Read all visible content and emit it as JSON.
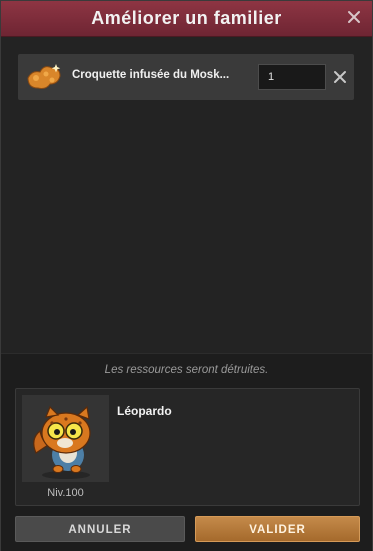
{
  "dialog": {
    "title": "Améliorer un familier",
    "close_icon": "close-icon"
  },
  "resource": {
    "icon": "croquette-icon",
    "name": "Croquette infusée du Mosk...",
    "quantity": "1",
    "remove_icon": "remove-icon"
  },
  "note": "Les ressources seront détruites.",
  "pet": {
    "name": "Léopardo",
    "level": "Niv.100",
    "portrait_icon": "leopardo-portrait"
  },
  "buttons": {
    "cancel": "ANNULER",
    "validate": "VALIDER"
  }
}
